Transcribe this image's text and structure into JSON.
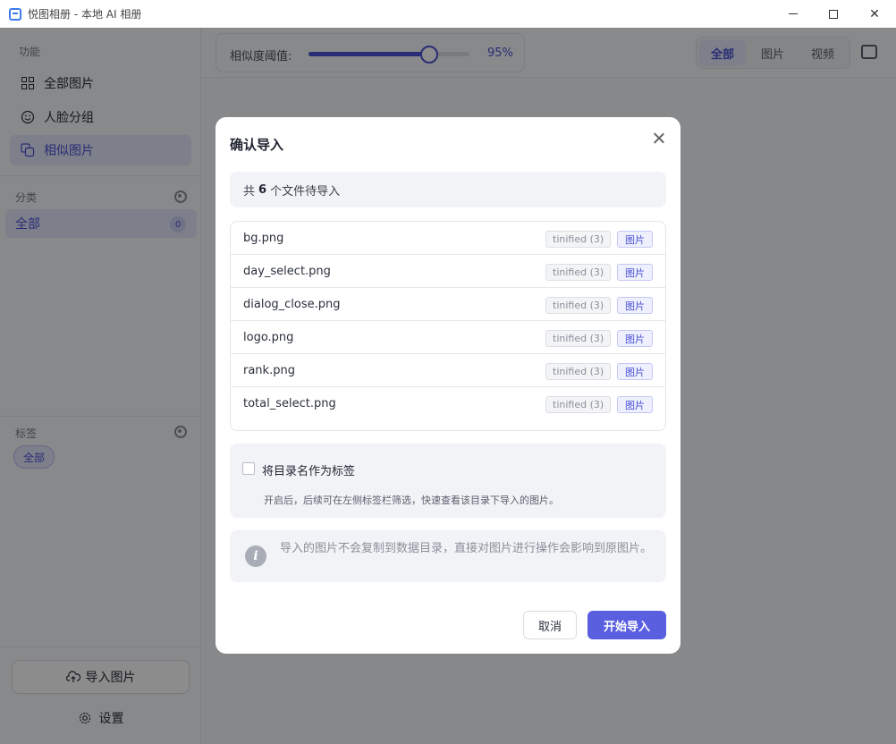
{
  "window": {
    "title": "悦图相册 - 本地 AI 相册"
  },
  "sidebar": {
    "features_title": "功能",
    "nav": [
      {
        "label": "全部图片",
        "icon": "grid-icon"
      },
      {
        "label": "人脸分组",
        "icon": "smile-icon"
      },
      {
        "label": "相似图片",
        "icon": "copy-icon",
        "active": true
      }
    ],
    "category_title": "分类",
    "category_all": "全部",
    "category_count": "0",
    "tags_title": "标签",
    "tag_all": "全部",
    "import_label": "导入图片",
    "settings_label": "设置"
  },
  "toolbar": {
    "similarity_label": "相似度阈值:",
    "similarity_value": "95%",
    "similarity_level": 0.75,
    "filters": [
      "全部",
      "图片",
      "视频"
    ],
    "active_filter": 0
  },
  "dialog": {
    "title": "确认导入",
    "summary_prefix": "共",
    "summary_count": "6",
    "summary_suffix": "个文件待导入",
    "files": [
      {
        "name": "bg.png",
        "source": "tinified (3)",
        "type": "图片"
      },
      {
        "name": "day_select.png",
        "source": "tinified (3)",
        "type": "图片"
      },
      {
        "name": "dialog_close.png",
        "source": "tinified (3)",
        "type": "图片"
      },
      {
        "name": "logo.png",
        "source": "tinified (3)",
        "type": "图片"
      },
      {
        "name": "rank.png",
        "source": "tinified (3)",
        "type": "图片"
      },
      {
        "name": "total_select.png",
        "source": "tinified (3)",
        "type": "图片"
      }
    ],
    "option_label": "将目录名作为标签",
    "option_hint": "开启后，后续可在左侧标签栏筛选，快速查看该目录下导入的图片。",
    "info_text": "导入的图片不会复制到数据目录，直接对图片进行操作会影响到原图片。",
    "cancel_label": "取消",
    "start_label": "开始导入"
  },
  "colors": {
    "accent": "#4b52d6",
    "primary_button": "#5a5fe0"
  }
}
